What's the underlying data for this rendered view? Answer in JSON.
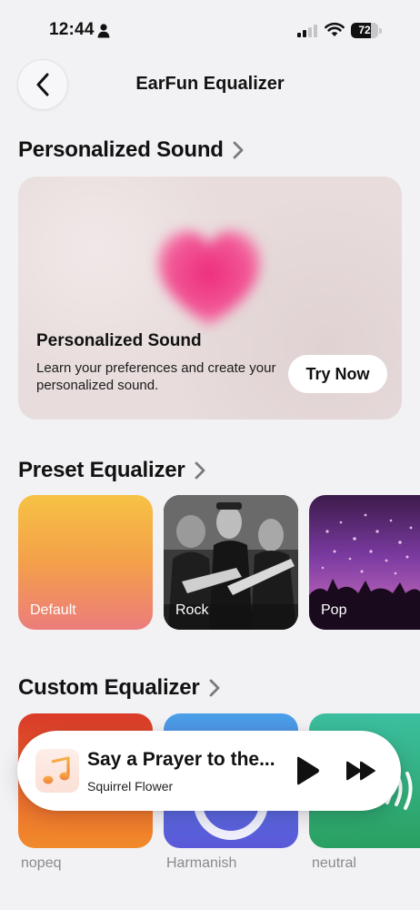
{
  "status": {
    "time": "12:44",
    "battery": "72",
    "battery_level": 0.72
  },
  "header": {
    "title": "EarFun Equalizer",
    "back_icon": "chevron-left-icon"
  },
  "personalized": {
    "heading": "Personalized Sound",
    "card_title": "Personalized Sound",
    "card_desc": "Learn your preferences and create your personalized sound.",
    "button": "Try Now"
  },
  "preset": {
    "heading": "Preset Equalizer",
    "tiles": [
      "Default",
      "Rock",
      "Pop"
    ]
  },
  "custom": {
    "heading": "Custom Equalizer",
    "tiles": [
      "nopeq",
      "Harmanish",
      "neutral"
    ]
  },
  "player": {
    "title": "Say a Prayer to the...",
    "artist": "Squirrel Flower"
  },
  "colors": {
    "accent_pink": "#ec3f86",
    "background": "#f2f2f5"
  }
}
